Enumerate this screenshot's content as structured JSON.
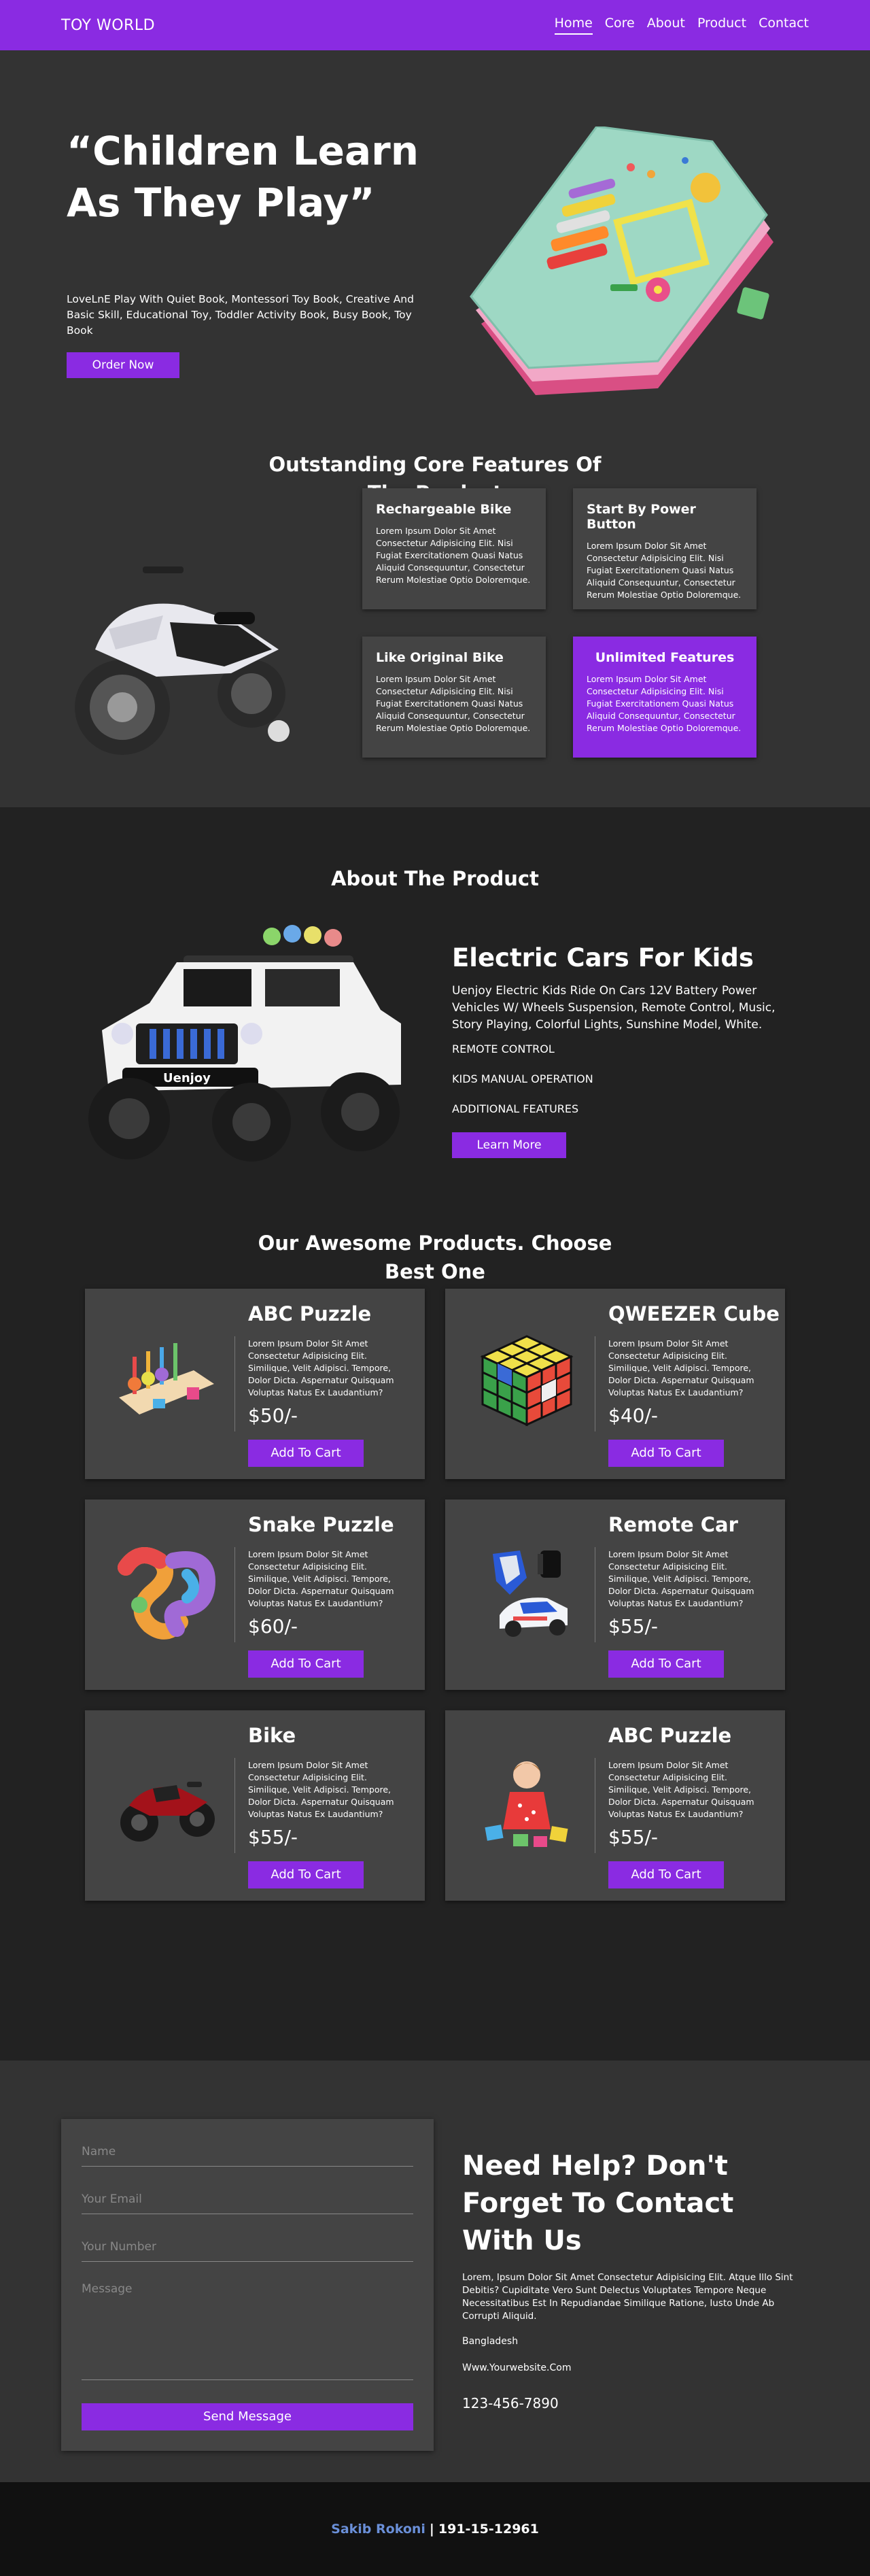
{
  "nav": {
    "logo": "TOY WORLD",
    "links": [
      "Home",
      "Core",
      "About",
      "Product",
      "Contact"
    ]
  },
  "hero": {
    "title": "“Children Learn As They Play”",
    "subtitle": "LoveLnE Play With Quiet Book, Montessori Toy Book, Creative And Basic Skill, Educational Toy, Toddler Activity Book, Busy Book, Toy Book",
    "button": "Order Now"
  },
  "features": {
    "title": "Outstanding Core Features Of The Product",
    "cards": [
      {
        "title": "Rechargeable Bike",
        "text": "Lorem Ipsum Dolor Sit Amet Consectetur Adipisicing Elit. Nisi Fugiat Exercitationem Quasi Natus Aliquid Consequuntur, Consectetur Rerum Molestiae Optio Doloremque."
      },
      {
        "title": "Start By Power Button",
        "text": "Lorem Ipsum Dolor Sit Amet Consectetur Adipisicing Elit. Nisi Fugiat Exercitationem Quasi Natus Aliquid Consequuntur, Consectetur Rerum Molestiae Optio Doloremque."
      },
      {
        "title": "Like Original Bike",
        "text": "Lorem Ipsum Dolor Sit Amet Consectetur Adipisicing Elit. Nisi Fugiat Exercitationem Quasi Natus Aliquid Consequuntur, Consectetur Rerum Molestiae Optio Doloremque."
      },
      {
        "title": "Unlimited Features",
        "text": "Lorem Ipsum Dolor Sit Amet Consectetur Adipisicing Elit. Nisi Fugiat Exercitationem Quasi Natus Aliquid Consequuntur, Consectetur Rerum Molestiae Optio Doloremque."
      }
    ]
  },
  "about": {
    "title": "About The Product",
    "heading": "Electric Cars For Kids",
    "description": "Uenjoy Electric Kids Ride On Cars 12V Battery Power Vehicles W/ Wheels Suspension, Remote Control, Music, Story Playing, Colorful Lights, Sunshine Model, White.",
    "list": [
      "REMOTE CONTROL",
      "KIDS MANUAL OPERATION",
      "ADDITIONAL FEATURES"
    ],
    "button": "Learn More",
    "car_brand": "Uenjoy"
  },
  "products": {
    "title": "Our Awesome Products. Choose Best One",
    "items": [
      {
        "name": "ABC Puzzle",
        "desc": "Lorem Ipsum Dolor Sit Amet Consectetur Adipisicing Elit. Similique, Velit Adipisci. Tempore, Dolor Dicta. Aspernatur Quisquam Voluptas Natus Ex Laudantium?",
        "price": "$50/-",
        "button": "Add To Cart"
      },
      {
        "name": "QWEEZER Cube",
        "desc": "Lorem Ipsum Dolor Sit Amet Consectetur Adipisicing Elit. Similique, Velit Adipisci. Tempore, Dolor Dicta. Aspernatur Quisquam Voluptas Natus Ex Laudantium?",
        "price": "$40/-",
        "button": "Add To Cart"
      },
      {
        "name": "Snake Puzzle",
        "desc": "Lorem Ipsum Dolor Sit Amet Consectetur Adipisicing Elit. Similique, Velit Adipisci. Tempore, Dolor Dicta. Aspernatur Quisquam Voluptas Natus Ex Laudantium?",
        "price": "$60/-",
        "button": "Add To Cart"
      },
      {
        "name": "Remote Car",
        "desc": "Lorem Ipsum Dolor Sit Amet Consectetur Adipisicing Elit. Similique, Velit Adipisci. Tempore, Dolor Dicta. Aspernatur Quisquam Voluptas Natus Ex Laudantium?",
        "price": "$55/-",
        "button": "Add To Cart"
      },
      {
        "name": "Bike",
        "desc": "Lorem Ipsum Dolor Sit Amet Consectetur Adipisicing Elit. Similique, Velit Adipisci. Tempore, Dolor Dicta. Aspernatur Quisquam Voluptas Natus Ex Laudantium?",
        "price": "$55/-",
        "button": "Add To Cart"
      },
      {
        "name": "ABC Puzzle",
        "desc": "Lorem Ipsum Dolor Sit Amet Consectetur Adipisicing Elit. Similique, Velit Adipisci. Tempore, Dolor Dicta. Aspernatur Quisquam Voluptas Natus Ex Laudantium?",
        "price": "$55/-",
        "button": "Add To Cart"
      }
    ]
  },
  "contact": {
    "placeholders": {
      "name": "Name",
      "email": "Your Email",
      "number": "Your Number",
      "message": "Message"
    },
    "button": "Send Message",
    "title": "Need Help? Don't Forget To Contact With Us",
    "description": "Lorem, Ipsum Dolor Sit Amet Consectetur Adipisicing Elit. Atque Illo Sint Debitis? Cupiditate Vero Sunt Delectus Voluptates Tempore Neque Necessitatibus Est In Repudiandae Similique Ratione, Iusto Unde Ab Corrupti Aliquid.",
    "location": "Bangladesh",
    "website": "Www.Yourwebsite.Com",
    "phone": "123-456-7890"
  },
  "footer": {
    "name": "Sakib Rokoni",
    "separator": "|",
    "id": "191-15-12961"
  },
  "colors": {
    "accent": "#8a2be2",
    "section_bg": "#333333",
    "dark_bg": "#222222",
    "card_bg": "#444444",
    "footer_bg": "#111111",
    "footer_name": "#6a8fd8"
  }
}
